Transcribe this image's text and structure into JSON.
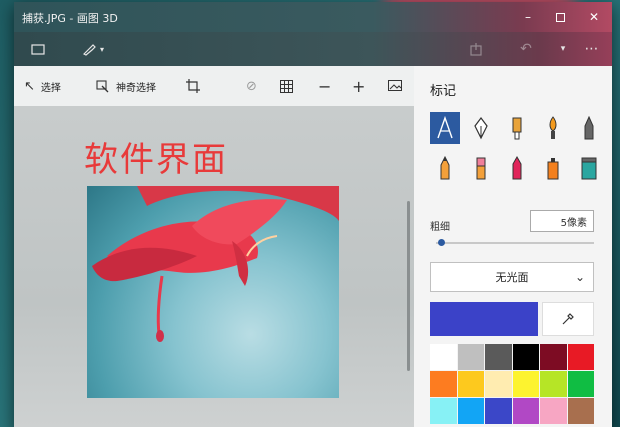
{
  "window": {
    "title": "捕获.JPG - 画图 3D"
  },
  "toolbar": {
    "select_label": "选择",
    "magic_select_label": "神奇选择"
  },
  "canvas": {
    "text": "软件界面"
  },
  "panel": {
    "title": "标记",
    "thickness_label": "粗细",
    "thickness_value": "5像素",
    "thickness_fraction": 0.03,
    "finish_label": "无光面",
    "current_color": "#3b42c8",
    "swatches": [
      "#ffffff",
      "#bfbfbf",
      "#5a5a5a",
      "#000000",
      "#7d0c23",
      "#e81a25",
      "#fd7c20",
      "#fdc91e",
      "#ffecb0",
      "#fdf32f",
      "#b6e526",
      "#10bd43",
      "#87f1f5",
      "#12a5f5",
      "#3b47c8",
      "#b148c5",
      "#f7a6c3",
      "#a86f4e"
    ]
  },
  "icons": {
    "menu": "folder-icon",
    "brush": "brush-icon"
  }
}
